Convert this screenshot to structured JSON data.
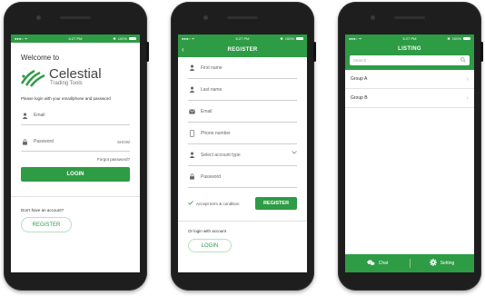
{
  "status_bar": {
    "time": "6:27 PM",
    "battery": "100%"
  },
  "login": {
    "welcome": "Welcome to",
    "logo_name": "Celestial",
    "logo_tagline": "Trading Tools",
    "instruction": "Please login with your email/phone and password",
    "email_placeholder": "Email",
    "password_placeholder": "Password",
    "show_label": "SHOW",
    "forgot": "Forgot password?",
    "login_button": "LOGIN",
    "no_account": "Don't have an account?",
    "register_button": "REGISTER"
  },
  "register": {
    "title": "REGISTER",
    "back_icon": "chevron-left-icon",
    "fields": {
      "first_name": "First name",
      "last_name": "Last name",
      "email": "Email",
      "phone": "Phone number",
      "account_type": "Select account type",
      "password": "Password"
    },
    "accept": "Accept term & condition",
    "register_button": "REGISTER",
    "or_login": "Or login with account",
    "login_button": "LOGIN"
  },
  "listing": {
    "title": "LISTING",
    "search_placeholder": "Search...",
    "items": [
      {
        "label": "Group A"
      },
      {
        "label": "Group B"
      }
    ],
    "tabs": [
      {
        "label": "Chat",
        "icon": "chat-icon"
      },
      {
        "label": "Setting",
        "icon": "gear-icon"
      }
    ]
  },
  "colors": {
    "accent": "#2e9b45",
    "phone_body": "#1e1e1e"
  }
}
